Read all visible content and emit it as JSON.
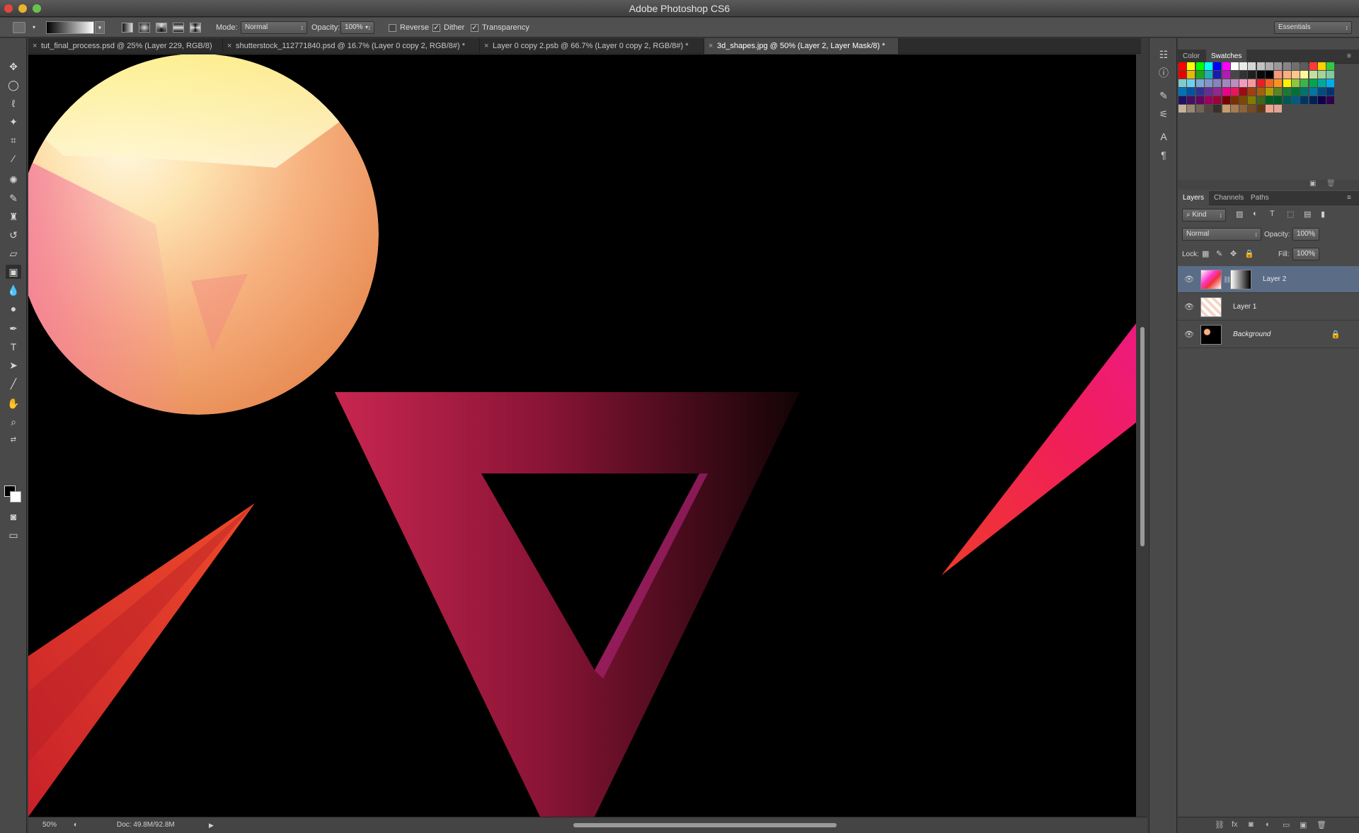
{
  "app": {
    "title": "Adobe Photoshop CS6"
  },
  "options": {
    "mode_label": "Mode:",
    "mode_value": "Normal",
    "opacity_label": "Opacity:",
    "opacity_value": "100%",
    "reverse_label": "Reverse",
    "dither_label": "Dither",
    "transparency_label": "Transparency",
    "workspace": "Essentials"
  },
  "tabs": [
    {
      "label": "tut_final_process.psd @ 25% (Layer 229, RGB/8)"
    },
    {
      "label": "shutterstock_112771840.psd @ 16.7% (Layer 0 copy 2, RGB/8#) *"
    },
    {
      "label": "Layer 0 copy 2.psb @ 66.7% (Layer 0 copy 2, RGB/8#) *"
    },
    {
      "label": "3d_shapes.jpg @ 50% (Layer 2, Layer Mask/8) *"
    }
  ],
  "status": {
    "zoom": "50%",
    "doc": "Doc: 49.8M/92.8M"
  },
  "color_panel": {
    "tab_color": "Color",
    "tab_swatches": "Swatches"
  },
  "layers_panel": {
    "tab_layers": "Layers",
    "tab_channels": "Channels",
    "tab_paths": "Paths",
    "kind_label": "Kind",
    "blend_mode": "Normal",
    "opacity_label": "Opacity:",
    "opacity_value": "100%",
    "lock_label": "Lock:",
    "fill_label": "Fill:",
    "fill_value": "100%",
    "layers": [
      {
        "name": "Layer 2",
        "selected": true
      },
      {
        "name": "Layer 1",
        "selected": false
      },
      {
        "name": "Background",
        "selected": false
      }
    ]
  },
  "colors": {
    "selection": "#5a6c86",
    "magenta": "#e8177a",
    "red": "#ef3a2a"
  }
}
